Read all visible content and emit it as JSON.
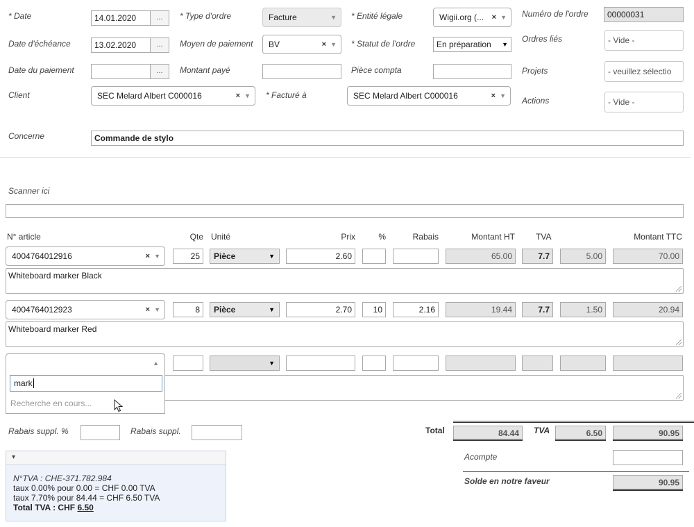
{
  "header": {
    "date_label": "* Date",
    "date_value": "14.01.2020",
    "due_label": "Date d'échéance",
    "due_value": "13.02.2020",
    "paid_date_label": "Date du paiement",
    "paid_date_value": "",
    "date_btn": "...",
    "client_label": "Client",
    "client_value": "SEC Melard Albert C000016",
    "order_type_label": "* Type d'ordre",
    "order_type_value": "Facture",
    "payment_method_label": "Moyen de paiement",
    "payment_method_value": "BV",
    "amount_paid_label": "Montant payé",
    "billed_to_label": "* Facturé à",
    "billed_to_value": "SEC Melard Albert C000016",
    "legal_entity_label": "* Entité légale",
    "legal_entity_value": "Wigii.org (...",
    "order_status_label": "* Statut de l'ordre",
    "order_status_value": "En préparation",
    "accounting_doc_label": "Pièce compta",
    "order_number_label": "Numéro de l'ordre",
    "order_number_value": "00000031",
    "linked_orders_label": "Ordres liés",
    "linked_orders_value": "- Vide -",
    "projects_label": "Projets",
    "projects_value": "- veuillez sélectio",
    "actions_label": "Actions",
    "actions_value": "- Vide -",
    "concerns_label": "Concerne",
    "concerns_value": "Commande de stylo",
    "scan_label": "Scanner ici"
  },
  "lines": {
    "col_article": "N° article",
    "col_qty": "Qte",
    "col_unit": "Unité",
    "col_price": "Prix",
    "col_pct": "%",
    "col_discount": "Rabais",
    "col_net": "Montant HT",
    "col_vat": "TVA",
    "col_gross": "Montant TTC",
    "rows": [
      {
        "article": "4004764012916",
        "qty": "25",
        "unit": "Pièce",
        "price": "2.60",
        "pct": "",
        "discount": "",
        "net": "65.00",
        "vat_rate": "7.7",
        "vat": "5.00",
        "gross": "70.00",
        "desc": "Whiteboard marker Black"
      },
      {
        "article": "4004764012923",
        "qty": "8",
        "unit": "Pièce",
        "price": "2.70",
        "pct": "10",
        "discount": "2.16",
        "net": "19.44",
        "vat_rate": "7.7",
        "vat": "1.50",
        "gross": "20.94",
        "desc": "Whiteboard marker Red"
      }
    ],
    "search_value": "mark",
    "search_status": "Recherche en cours..."
  },
  "footer": {
    "extra_pct_label": "Rabais suppl. %",
    "extra_label": "Rabais suppl.",
    "total_label": "Total",
    "total_net": "84.44",
    "tva_label": "TVA",
    "total_vat": "6.50",
    "total_gross": "90.95",
    "deposit_label": "Acompte",
    "balance_label": "Solde en notre faveur",
    "balance_value": "90.95",
    "vat_panel": {
      "toggle": "▾",
      "line1": "N°TVA : CHE-371.782.984",
      "line2": "taux 0.00% pour 0.00 = CHF 0.00 TVA",
      "line3": "taux 7.70% pour 84.44 = CHF 6.50 TVA",
      "total_prefix": "Total TVA : CHF ",
      "total_value": "6.50"
    }
  },
  "colors": {
    "readonly": "#e4e4e4",
    "panel_bg": "#eef3fb",
    "panel_border": "#c5d3e6",
    "focus": "#5b9dd9"
  }
}
